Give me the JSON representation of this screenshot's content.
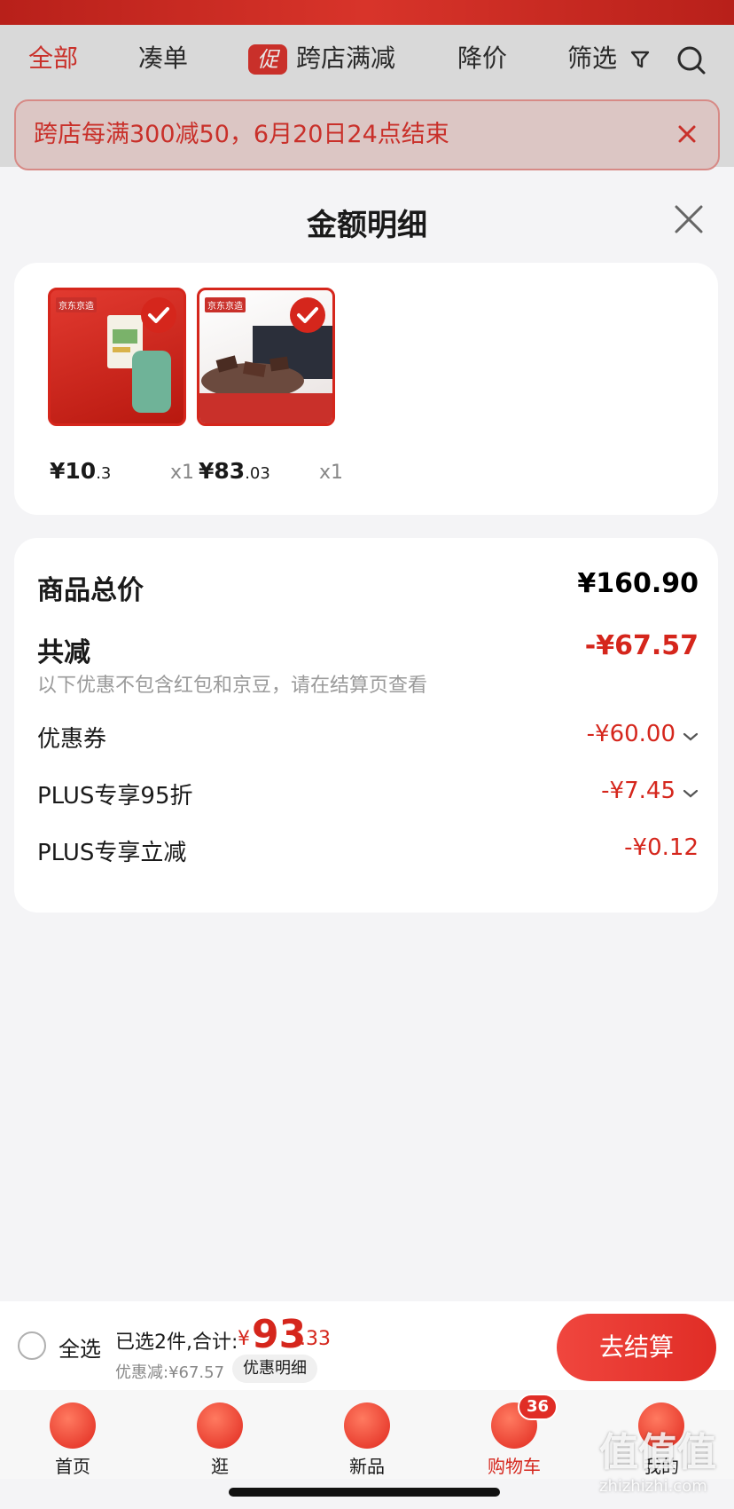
{
  "nav": {
    "tabs": [
      {
        "label": "全部",
        "active": true
      },
      {
        "label": "凑单",
        "active": false
      },
      {
        "label": "跨店满减",
        "active": false,
        "tag": "促"
      },
      {
        "label": "降价",
        "active": false
      },
      {
        "label": "筛选",
        "active": false
      }
    ],
    "search_icon": "search-icon"
  },
  "banner": {
    "text": "跨店每满300减50，6月20日24点结束"
  },
  "sheet": {
    "title": "金额明细",
    "products": [
      {
        "price_int": "¥10",
        "price_dec": ".3",
        "qty": "x1",
        "thumb_label": "京东京造"
      },
      {
        "price_int": "¥83",
        "price_dec": ".03",
        "qty": "x1",
        "thumb_label": "京东京造"
      }
    ],
    "summary": {
      "total_label": "商品总价",
      "total_value": "¥160.90",
      "reduce_label": "共减",
      "reduce_value": "-¥67.57",
      "note": "以下优惠不包含红包和京豆，请在结算页查看",
      "items": [
        {
          "label": "优惠券",
          "value": "-¥60.00",
          "expandable": true
        },
        {
          "label": "PLUS专享95折",
          "value": "-¥7.45",
          "expandable": true
        },
        {
          "label": "PLUS专享立减",
          "value": "-¥0.12",
          "expandable": false
        }
      ]
    }
  },
  "checkout": {
    "select_all": "全选",
    "selected": "已选2件,合计:",
    "total_symbol": "¥",
    "total_int": "93",
    "total_dec": ".33",
    "discount": "优惠减:¥67.57",
    "detail_button": "优惠明细",
    "pay_button": "去结算"
  },
  "tabbar": {
    "items": [
      {
        "label": "首页",
        "active": false
      },
      {
        "label": "逛",
        "active": false
      },
      {
        "label": "新品",
        "active": false
      },
      {
        "label": "购物车",
        "active": true
      },
      {
        "label": "我的",
        "active": false
      }
    ],
    "cart_badge": "36"
  },
  "watermark": {
    "text": "值值值",
    "url": "zhizhizhi.com"
  },
  "colors": {
    "accent": "#d5261c",
    "pay_button": "#e02d26"
  }
}
